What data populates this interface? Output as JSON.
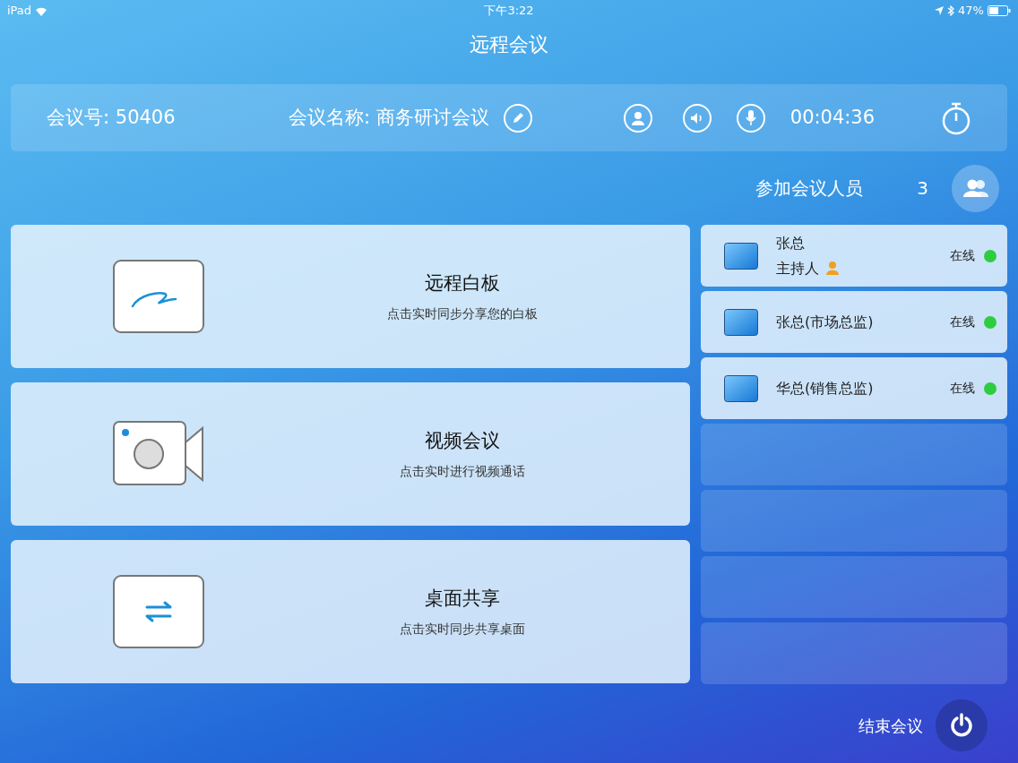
{
  "status_bar": {
    "device": "iPad",
    "time": "下午3:22",
    "battery": "47%"
  },
  "title": "远程会议",
  "info_bar": {
    "meeting_id_label": "会议号:",
    "meeting_id": "50406",
    "meeting_name_label": "会议名称:",
    "meeting_name": "商务研讨会议",
    "timer": "00:04:36"
  },
  "participants_header": {
    "label": "参加会议人员",
    "count": "3"
  },
  "features": [
    {
      "kind": "whiteboard",
      "title": "远程白板",
      "subtitle": "点击实时同步分享您的白板"
    },
    {
      "kind": "video",
      "title": "视频会议",
      "subtitle": "点击实时进行视频通话"
    },
    {
      "kind": "desktop",
      "title": "桌面共享",
      "subtitle": "点击实时同步共享桌面"
    }
  ],
  "participants": [
    {
      "name": "张总",
      "role": "主持人",
      "status": "在线",
      "color": "#2ecc40"
    },
    {
      "name": "张总(市场总监)",
      "status": "在线",
      "color": "#2ecc40"
    },
    {
      "name": "华总(销售总监)",
      "status": "在线",
      "color": "#2ecc40"
    }
  ],
  "end_button": {
    "label": "结束会议"
  }
}
